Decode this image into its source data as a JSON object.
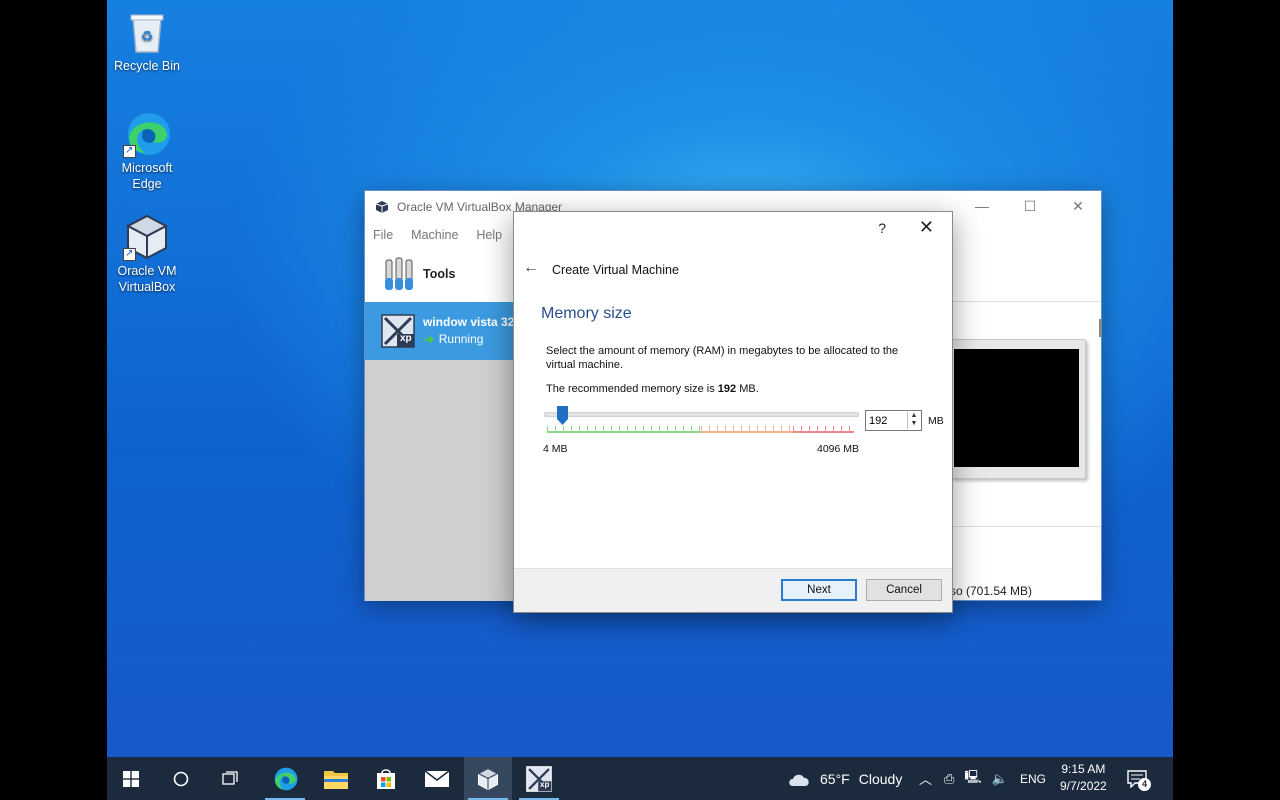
{
  "desktop": {
    "icons": [
      {
        "label": "Recycle Bin"
      },
      {
        "label": "Microsoft Edge"
      },
      {
        "label": "Oracle VM VirtualBox"
      }
    ]
  },
  "vbox_window": {
    "title": "Oracle VM VirtualBox Manager",
    "menu": [
      "File",
      "Machine",
      "Help"
    ],
    "tools_label": "Tools",
    "vm_name": "window vista 32",
    "vm_status": "Running",
    "vm_badge": "xp",
    "iso_text": "so (701.54 MB)"
  },
  "dialog": {
    "help": "?",
    "close": "✕",
    "back": "←",
    "wizard_title": "Create Virtual Machine",
    "section_title": "Memory size",
    "description": "Select the amount of memory (RAM) in megabytes to be allocated to the virtual machine.",
    "recommend_prefix": "The recommended memory size is ",
    "recommend_value": "192",
    "recommend_suffix": " MB.",
    "memory_value": "192",
    "unit": "MB",
    "slider_min_label": "4 MB",
    "slider_max_label": "4096 MB",
    "slider_value_mb": 192,
    "next_label": "Next",
    "cancel_label": "Cancel"
  },
  "taskbar": {
    "weather_temp": "65°F",
    "weather_text": "Cloudy",
    "lang": "ENG",
    "time": "9:15 AM",
    "date": "9/7/2022",
    "notification_count": "4",
    "app_badge": "xp"
  },
  "colors": {
    "accent": "#2b7bd4",
    "selection": "#3c9be0",
    "section_title": "#2a4d8f",
    "taskbar": "#1b2a3c"
  }
}
